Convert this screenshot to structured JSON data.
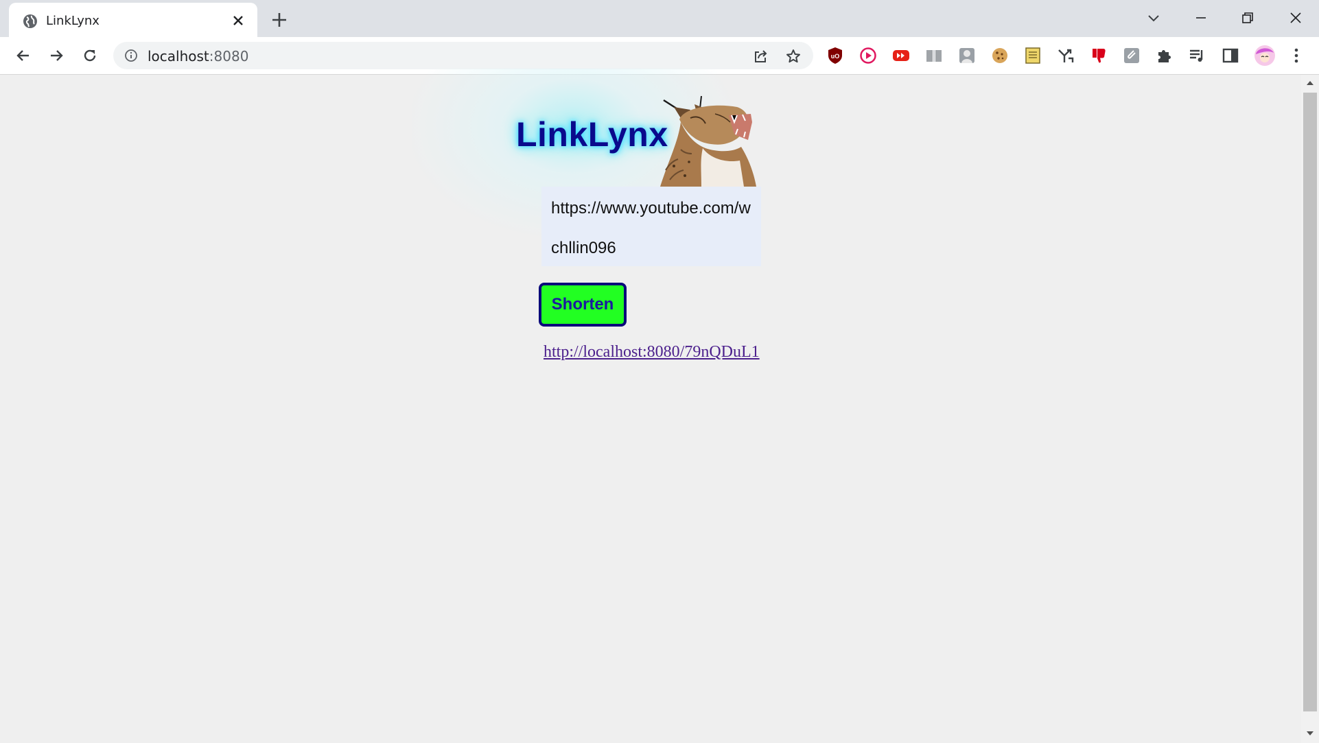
{
  "browser": {
    "tab": {
      "title": "LinkLynx",
      "favicon": "globe-icon"
    },
    "address": {
      "host": "localhost",
      "port": ":8080"
    },
    "extensions": [
      "ublock-icon",
      "play-circle-icon",
      "youtube-forward-icon",
      "book-icon",
      "portrait-icon",
      "cookie-icon",
      "notepad-icon",
      "branch-arrows-icon",
      "thumbs-down-icon",
      "paperclip-icon",
      "puzzle-icon",
      "media-queue-icon",
      "sidepanel-icon",
      "profile-avatar-icon",
      "kebab-menu-icon"
    ],
    "accent_colors": {
      "tabstrip": "#dee1e6",
      "toolbar": "#ffffff"
    }
  },
  "page": {
    "logo_text": "LinkLynx",
    "url_input": {
      "value": "https://www.youtube.com/w"
    },
    "alias_input": {
      "value": "chllin096"
    },
    "shorten_button": "Shorten",
    "short_link": "http://localhost:8080/79nQDuL1",
    "colors": {
      "button_bg": "#22ff22",
      "button_border": "#0a0a7a",
      "title": "#0a0a8c",
      "form_bg": "#e7edf9",
      "link": "#4b1f8c"
    }
  }
}
